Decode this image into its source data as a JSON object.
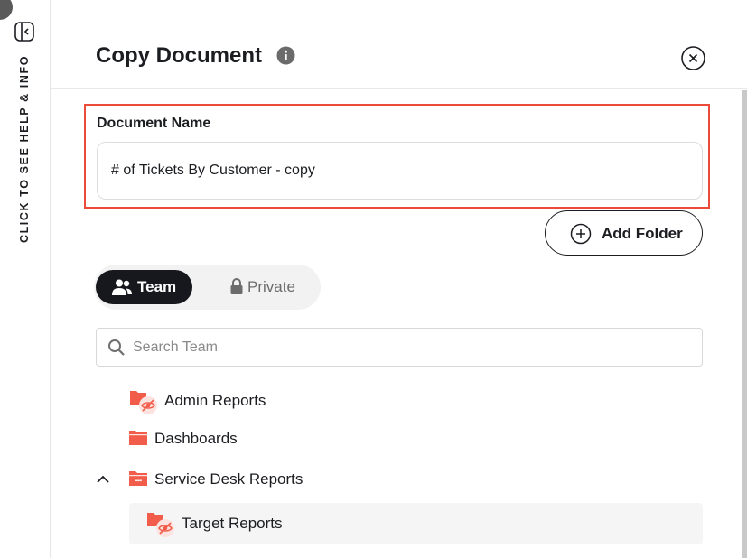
{
  "help_rail": {
    "label": "CLICK TO SEE HELP & INFO"
  },
  "dialog": {
    "title": "Copy Document"
  },
  "document_name": {
    "label": "Document Name",
    "value": "# of Tickets By Customer - copy"
  },
  "add_folder": {
    "label": "Add Folder"
  },
  "scope_tabs": {
    "team": "Team",
    "private": "Private",
    "selected": "Team"
  },
  "search": {
    "placeholder": "Search Team",
    "value": ""
  },
  "folders": {
    "admin_reports": "Admin Reports",
    "dashboards": "Dashboards",
    "service_desk_reports": "Service Desk Reports",
    "target_reports": "Target Reports"
  },
  "colors": {
    "folder": "#f25c4a",
    "highlight_border": "#ec4b3a",
    "active_tab": "#16181d"
  }
}
